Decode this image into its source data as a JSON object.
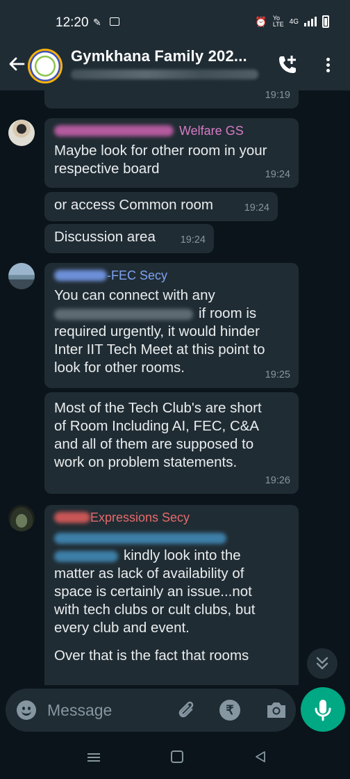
{
  "status_bar": {
    "time": "12:20",
    "icons_left": [
      "whatsapp-status-icon",
      "outlook-icon"
    ],
    "icons_right": [
      "alarm-icon",
      "volte-icon",
      "4g-signal-icon",
      "signal-icon",
      "battery-icon"
    ],
    "network": "4G"
  },
  "header": {
    "title": "Gymkhana Family 202..."
  },
  "messages": [
    {
      "id": "m0",
      "text": "",
      "time": "19:19"
    },
    {
      "id": "m1",
      "sender_role": "Welfare GS",
      "sender_color": "#d67bc6",
      "text": "Maybe look for other room in your respective board",
      "time": "19:24"
    },
    {
      "id": "m2",
      "text": "or access Common room",
      "time": "19:24"
    },
    {
      "id": "m3",
      "text": "Discussion area",
      "time": "19:24"
    },
    {
      "id": "m4",
      "sender_role": "-FEC Secy",
      "sender_color": "#7ea3f2",
      "line1": "You can connect with any",
      "line2_after_blur": "if room is",
      "line3": "required urgently, it would hinder",
      "line4": "Inter IIT Tech Meet at this point to",
      "line5": "look for other rooms.",
      "time": "19:25"
    },
    {
      "id": "m5",
      "line1": "Most of the Tech Club's are short",
      "line2": "of Room Including AI, FEC, C&A",
      "line3": "and all of them are supposed to",
      "line4": "work on problem statements.",
      "time": "19:26"
    },
    {
      "id": "m6",
      "sender_role": "Expressions Secy",
      "sender_color": "#e56b6b",
      "line2_after_blur": "kindly look into the",
      "line3": "matter as lack of availability of",
      "line4": "space is certainly an issue...not",
      "line5": "with tech clubs or cult clubs, but",
      "line6": "every club and event.",
      "line7": "Over that is the fact that rooms"
    }
  ],
  "input": {
    "placeholder": "Message"
  },
  "colors": {
    "accent": "#00a884",
    "bubble": "#202c33",
    "background": "#0b141a",
    "header": "#1f2c34"
  }
}
